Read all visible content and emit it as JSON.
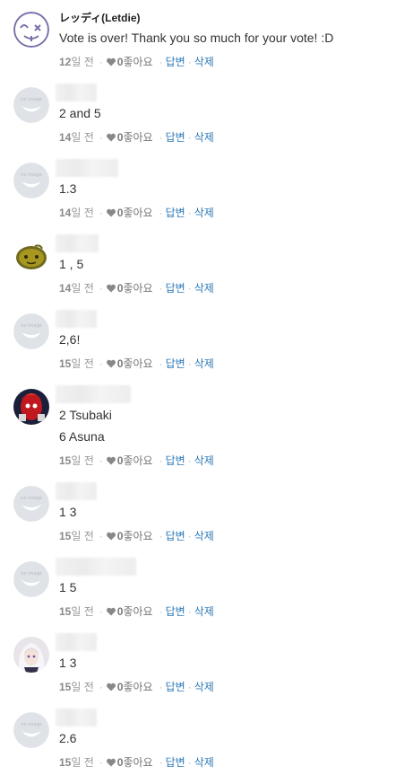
{
  "comments": [
    {
      "author": "レッディ(Letdie)",
      "avatar": "letdie-avatar",
      "lines": [
        "Vote is over! Thank you so much for your vote! :D"
      ],
      "days": "12",
      "time_suffix": "일 전",
      "likes": "0",
      "like_label": "좋아요",
      "reply": "답변",
      "delete": "삭제"
    },
    {
      "author": "",
      "avatar": "no-image-avatar",
      "lines": [
        "2 and 5"
      ],
      "days": "14",
      "time_suffix": "일 전",
      "likes": "0",
      "like_label": "좋아요",
      "reply": "답변",
      "delete": "삭제"
    },
    {
      "author": "",
      "avatar": "no-image-avatar",
      "lines": [
        "1.3"
      ],
      "days": "14",
      "time_suffix": "일 전",
      "likes": "0",
      "like_label": "좋아요",
      "reply": "답변",
      "delete": "삭제"
    },
    {
      "author": "",
      "avatar": "olive-blob-avatar",
      "lines": [
        "1 , 5"
      ],
      "days": "14",
      "time_suffix": "일 전",
      "likes": "0",
      "like_label": "좋아요",
      "reply": "답변",
      "delete": "삭제"
    },
    {
      "author": "",
      "avatar": "no-image-avatar",
      "lines": [
        "2,6!"
      ],
      "days": "15",
      "time_suffix": "일 전",
      "likes": "0",
      "like_label": "좋아요",
      "reply": "답변",
      "delete": "삭제"
    },
    {
      "author": "",
      "avatar": "red-character-avatar",
      "lines": [
        "2 Tsubaki",
        "6 Asuna"
      ],
      "days": "15",
      "time_suffix": "일 전",
      "likes": "0",
      "like_label": "좋아요",
      "reply": "답변",
      "delete": "삭제"
    },
    {
      "author": "",
      "avatar": "no-image-avatar",
      "lines": [
        "1 3"
      ],
      "days": "15",
      "time_suffix": "일 전",
      "likes": "0",
      "like_label": "좋아요",
      "reply": "답변",
      "delete": "삭제"
    },
    {
      "author": "",
      "avatar": "no-image-avatar",
      "lines": [
        "1 5"
      ],
      "days": "15",
      "time_suffix": "일 전",
      "likes": "0",
      "like_label": "좋아요",
      "reply": "답변",
      "delete": "삭제"
    },
    {
      "author": "",
      "avatar": "white-hair-character-avatar",
      "lines": [
        "1 3"
      ],
      "days": "15",
      "time_suffix": "일 전",
      "likes": "0",
      "like_label": "좋아요",
      "reply": "답변",
      "delete": "삭제"
    },
    {
      "author": "",
      "avatar": "no-image-avatar",
      "lines": [
        "2.6"
      ],
      "days": "15",
      "time_suffix": "일 전",
      "likes": "0",
      "like_label": "좋아요",
      "reply": "답변",
      "delete": "삭제"
    }
  ],
  "colors": {
    "link": "#2d7ab8",
    "muted": "#999999",
    "text": "#333333"
  },
  "avatar_text": "no image"
}
